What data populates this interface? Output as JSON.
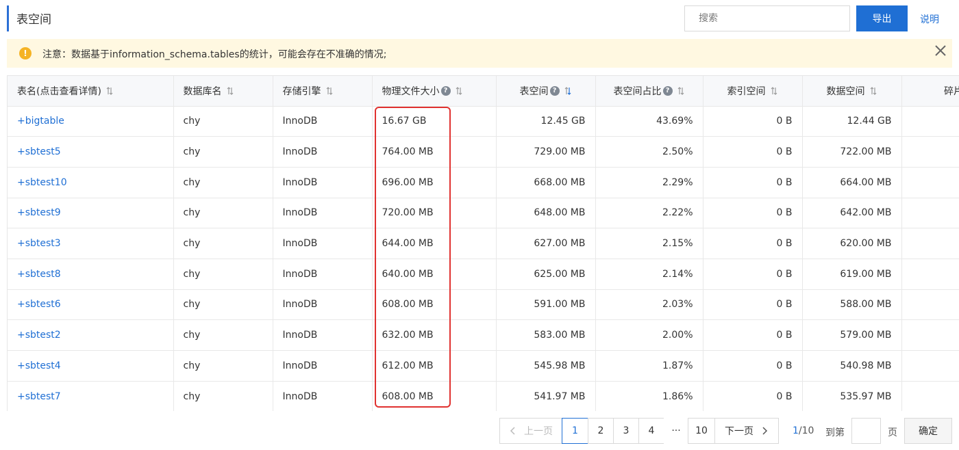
{
  "header": {
    "title": "表空间",
    "search_placeholder": "搜索",
    "export_label": "导出",
    "help_label": "说明"
  },
  "alert": {
    "message": "注意：数据基于information_schema.tables的统计，可能会存在不准确的情况;"
  },
  "table": {
    "columns": [
      {
        "label": "表名(点击查看详情)",
        "help": false,
        "sort": "none"
      },
      {
        "label": "数据库名",
        "help": false,
        "sort": "none"
      },
      {
        "label": "存储引擎",
        "help": false,
        "sort": "none"
      },
      {
        "label": "物理文件大小",
        "help": true,
        "sort": "none"
      },
      {
        "label": "表空间",
        "help": true,
        "sort": "desc"
      },
      {
        "label": "表空间占比",
        "help": true,
        "sort": "none"
      },
      {
        "label": "索引空间",
        "help": false,
        "sort": "none"
      },
      {
        "label": "数据空间",
        "help": false,
        "sort": "none"
      },
      {
        "label": "碎片率",
        "help": false,
        "sort": "none"
      }
    ],
    "rows": [
      {
        "name": "+bigtable",
        "db": "chy",
        "engine": "InnoDB",
        "physical": "16.67 GB",
        "tablespace": "12.45 GB",
        "ratio": "43.69%",
        "index": "0 B",
        "data": "12.44 GB"
      },
      {
        "name": "+sbtest5",
        "db": "chy",
        "engine": "InnoDB",
        "physical": "764.00 MB",
        "tablespace": "729.00 MB",
        "ratio": "2.50%",
        "index": "0 B",
        "data": "722.00 MB"
      },
      {
        "name": "+sbtest10",
        "db": "chy",
        "engine": "InnoDB",
        "physical": "696.00 MB",
        "tablespace": "668.00 MB",
        "ratio": "2.29%",
        "index": "0 B",
        "data": "664.00 MB"
      },
      {
        "name": "+sbtest9",
        "db": "chy",
        "engine": "InnoDB",
        "physical": "720.00 MB",
        "tablespace": "648.00 MB",
        "ratio": "2.22%",
        "index": "0 B",
        "data": "642.00 MB"
      },
      {
        "name": "+sbtest3",
        "db": "chy",
        "engine": "InnoDB",
        "physical": "644.00 MB",
        "tablespace": "627.00 MB",
        "ratio": "2.15%",
        "index": "0 B",
        "data": "620.00 MB"
      },
      {
        "name": "+sbtest8",
        "db": "chy",
        "engine": "InnoDB",
        "physical": "640.00 MB",
        "tablespace": "625.00 MB",
        "ratio": "2.14%",
        "index": "0 B",
        "data": "619.00 MB"
      },
      {
        "name": "+sbtest6",
        "db": "chy",
        "engine": "InnoDB",
        "physical": "608.00 MB",
        "tablespace": "591.00 MB",
        "ratio": "2.03%",
        "index": "0 B",
        "data": "588.00 MB"
      },
      {
        "name": "+sbtest2",
        "db": "chy",
        "engine": "InnoDB",
        "physical": "632.00 MB",
        "tablespace": "583.00 MB",
        "ratio": "2.00%",
        "index": "0 B",
        "data": "579.00 MB"
      },
      {
        "name": "+sbtest4",
        "db": "chy",
        "engine": "InnoDB",
        "physical": "612.00 MB",
        "tablespace": "545.98 MB",
        "ratio": "1.87%",
        "index": "0 B",
        "data": "540.98 MB"
      },
      {
        "name": "+sbtest7",
        "db": "chy",
        "engine": "InnoDB",
        "physical": "608.00 MB",
        "tablespace": "541.97 MB",
        "ratio": "1.86%",
        "index": "0 B",
        "data": "535.97 MB"
      }
    ]
  },
  "pagination": {
    "prev_label": "上一页",
    "pages": [
      "1",
      "2",
      "3",
      "4"
    ],
    "ellipsis": "···",
    "last_page": "10",
    "next_label": "下一页",
    "current": "1",
    "total": "/10",
    "goto_label": "到第",
    "page_unit": "页",
    "confirm_label": "确定"
  },
  "colors": {
    "accent": "#1f6fd4",
    "alert_bg": "#fff8e1",
    "warn": "#f5b324",
    "highlight": "#e0312f"
  }
}
